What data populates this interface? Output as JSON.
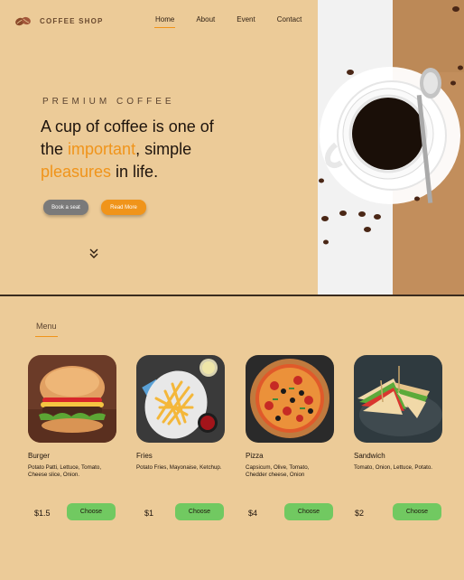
{
  "brand": {
    "name": "COFFEE SHOP"
  },
  "nav": {
    "items": [
      "Home",
      "About",
      "Event",
      "Contact"
    ],
    "active": "Home"
  },
  "hero": {
    "eyebrow": "PREMIUM COFFEE",
    "line1": "A cup of coffee is one of",
    "line2_pre": "the ",
    "line2_hl": "important",
    "line2_post": ", simple",
    "line3_hl": "pleasures",
    "line3_post": " in life.",
    "btn_seat": "Book a seat",
    "btn_more": "Read More"
  },
  "menu": {
    "title": "Menu",
    "choose_label": "Choose",
    "items": [
      {
        "name": "Burger",
        "desc": "Potato Patti, Lettuce, Tomato, Cheese slice, Onion.",
        "price": "$1.5"
      },
      {
        "name": "Fries",
        "desc": "Potato Fries, Mayonaise, Ketchup.",
        "price": "$1"
      },
      {
        "name": "Pizza",
        "desc": "Capsicum, Olive, Tomato, Chedder cheese, Onion",
        "price": "$4"
      },
      {
        "name": "Sandwich",
        "desc": "Tomato, Onion, Lettuce, Potato.",
        "price": "$2"
      }
    ]
  },
  "colors": {
    "background": "#eccb98",
    "accent": "#f0941a",
    "choose_button": "#71c961"
  }
}
